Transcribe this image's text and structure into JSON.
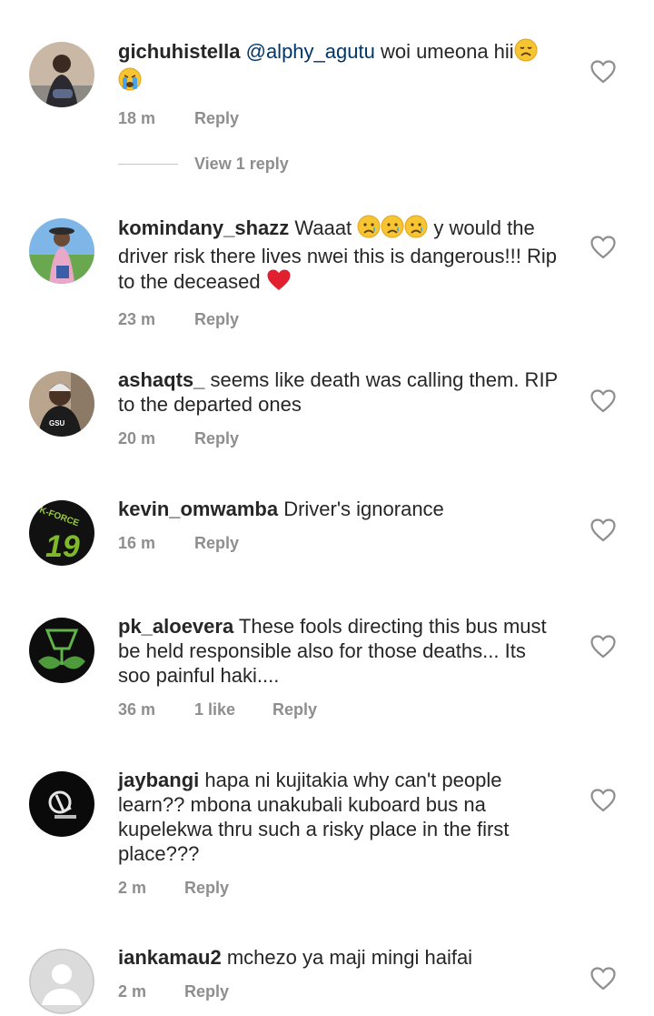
{
  "comments": [
    {
      "username": "gichuhistella",
      "mention": "@alphy_agutu",
      "text": " woi umeona hii",
      "time": "18 m",
      "reply": "Reply",
      "view_replies": "View 1 reply"
    },
    {
      "username": "komindany_shazz",
      "text1": " Waaat ",
      "text2": " y would the driver risk there lives nwei this is dangerous!!! Rip to the deceased ",
      "time": "23 m",
      "reply": "Reply"
    },
    {
      "username": "ashaqts_",
      "text": " seems like death was calling them. RIP to the departed ones",
      "time": "20 m",
      "reply": "Reply"
    },
    {
      "username": "kevin_omwamba",
      "text": " Driver's ignorance",
      "time": "16 m",
      "reply": "Reply"
    },
    {
      "username": "pk_aloevera",
      "text": " These fools directing this bus must be held responsible also for those deaths... Its soo painful haki....",
      "time": "36 m",
      "likes": "1 like",
      "reply": "Reply"
    },
    {
      "username": "jaybangi",
      "text": " hapa ni kujitakia why can't people learn?? mbona unakubali kuboard bus na kupelekwa thru such a risky place in the first place???",
      "time": "2 m",
      "reply": "Reply"
    },
    {
      "username": "iankamau2",
      "text": " mchezo ya maji mingi haifai",
      "time": "2 m",
      "reply": "Reply"
    }
  ],
  "avatar_logo_text": "K-FORCE",
  "avatar_jersey_number": "19",
  "colors": {
    "muted": "#8e8e8e",
    "mention": "#00376b",
    "heart_red": "#e0202e"
  },
  "icons": {
    "like": "heart-outline-icon",
    "disappointed": "disappointed-face-icon",
    "crying": "crying-face-icon",
    "red_heart": "red-heart-icon"
  }
}
